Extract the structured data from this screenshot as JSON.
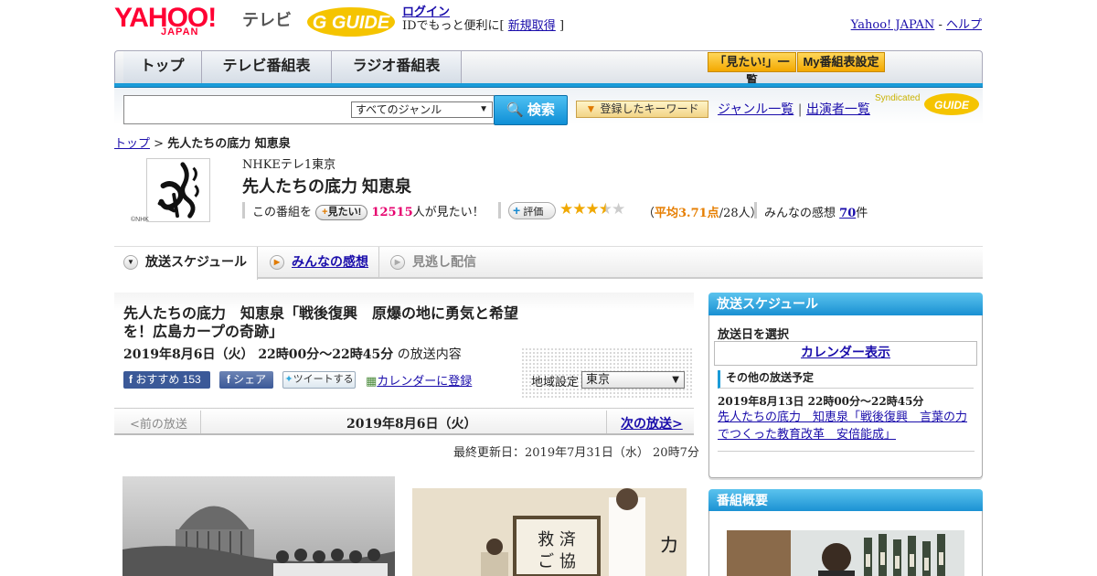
{
  "header": {
    "logo_yahoo": "YAHOO!",
    "logo_japan": "JAPAN",
    "logo_tv": "テレビ",
    "login": "ログイン",
    "id_text": "IDでもっと便利に[",
    "register": "新規取得",
    "id_close": "]",
    "yahoo_japan": "Yahoo! JAPAN",
    "dash": "-",
    "help": "ヘルプ"
  },
  "nav": {
    "tabs": [
      "トップ",
      "テレビ番組表",
      "ラジオ番組表"
    ],
    "mitai_list": "「見たい!」一覧",
    "my_schedule": "My番組表設定"
  },
  "search": {
    "genre_selected": "すべてのジャンル",
    "button": "検索",
    "keywords": "登録したキーワード",
    "genre_list": "ジャンル一覧",
    "sep": "|",
    "performer_list": "出演者一覧",
    "syndicated": "Syndicated"
  },
  "breadcrumb": {
    "top": "トップ",
    "sep": ">",
    "current": "先人たちの底力 知恵泉"
  },
  "program": {
    "channel": "NHKEテレ1東京",
    "title": "先人たちの底力 知恵泉",
    "this_program": "この番組を",
    "mitai_btn": "見たい!",
    "mitai_count": "12515",
    "mitai_suffix": "人が見たい！",
    "rate_btn": "評価",
    "rating": 3.71,
    "stars_text": "★★★★☆",
    "avg_open": "（",
    "avg_label": "平均3.71点",
    "avg_suffix": "/28人）",
    "kanso_label": "みんなの感想",
    "kanso_count": "70",
    "kanso_unit": "件",
    "nhk_mark": "©NHK"
  },
  "subtabs": [
    "放送スケジュール",
    "みんなの感想",
    "見逃し配信"
  ],
  "episode": {
    "title": "先人たちの底力　知恵泉「戦後復興　原爆の地に勇気と希望を！広島カープの奇跡」",
    "date": "2019年8月6日（火） 22時00分～22時45分",
    "date_suffix": "の放送内容",
    "fb_recommend": "おすすめ",
    "fb_count": "153",
    "fb_share": "シェア",
    "tweet": "ツイートする",
    "calendar_register": "カレンダーに登録",
    "region_label": "地域設定",
    "region_value": "東京"
  },
  "pager": {
    "prev": "<前の放送",
    "current": "2019年8月6日（火）",
    "next": "次の放送>"
  },
  "updated": "最終更新日：2019年7月31日（水） 20時7分",
  "sidebar": {
    "schedule_head": "放送スケジュール",
    "select_date": "放送日を選択",
    "calendar_btn": "カレンダー表示",
    "other_label": "その他の放送予定",
    "other_date": "2019年8月13日 22時00分～22時45分",
    "other_title": "先人たちの底力　知恵泉「戦後復興　言葉の力でつくった教育改革　安倍能成」",
    "summary_head": "番組概要"
  },
  "colors": {
    "accent_blue": "#1a9bd8",
    "pink": "#e6006e",
    "orange": "#e67e00",
    "yahoo_red": "#ff0033"
  }
}
